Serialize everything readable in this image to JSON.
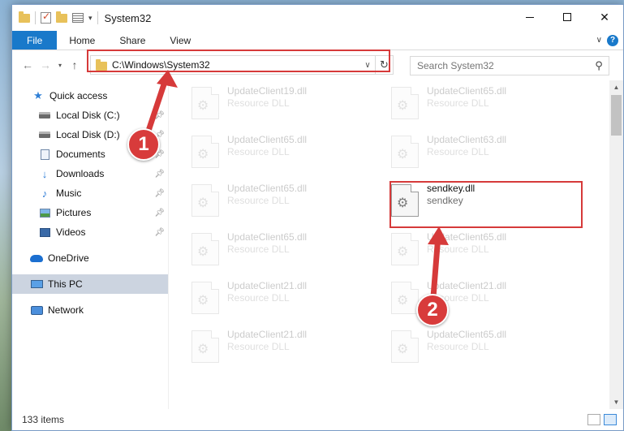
{
  "window": {
    "title": "System32"
  },
  "ribbon": {
    "tabs": [
      {
        "label": "File"
      },
      {
        "label": "Home"
      },
      {
        "label": "Share"
      },
      {
        "label": "View"
      }
    ]
  },
  "address": {
    "path": "C:\\Windows\\System32"
  },
  "search": {
    "placeholder": "Search System32"
  },
  "nav": {
    "items": [
      {
        "label": "Quick access",
        "icon": "star-icon"
      },
      {
        "label": "Local Disk (C:)",
        "icon": "drive-icon",
        "pinned": true
      },
      {
        "label": "Local Disk (D:)",
        "icon": "drive-icon",
        "pinned": true
      },
      {
        "label": "Documents",
        "icon": "documents-icon",
        "pinned": true
      },
      {
        "label": "Downloads",
        "icon": "downloads-icon",
        "pinned": true
      },
      {
        "label": "Music",
        "icon": "music-icon",
        "pinned": true
      },
      {
        "label": "Pictures",
        "icon": "pictures-icon",
        "pinned": true
      },
      {
        "label": "Videos",
        "icon": "videos-icon",
        "pinned": true
      },
      {
        "label": "OneDrive",
        "icon": "onedrive-icon"
      },
      {
        "label": "This PC",
        "icon": "this-pc-icon",
        "selected": true
      },
      {
        "label": "Network",
        "icon": "network-icon"
      }
    ]
  },
  "files": [
    {
      "name": "UpdateClient19.dll",
      "type": "Resource DLL",
      "faded": true
    },
    {
      "name": "UpdateClient65.dll",
      "type": "Resource DLL",
      "faded": true
    },
    {
      "name": "UpdateClient65.dll",
      "type": "Resource DLL",
      "faded": true
    },
    {
      "name": "UpdateClient63.dll",
      "type": "Resource DLL",
      "faded": true
    },
    {
      "name": "UpdateClient65.dll",
      "type": "Resource DLL",
      "faded": true
    },
    {
      "name": "sendkey.dll",
      "type": "sendkey",
      "faded": false
    },
    {
      "name": "UpdateClient65.dll",
      "type": "Resource DLL",
      "faded": true
    },
    {
      "name": "UpdateClient65.dll",
      "type": "Resource DLL",
      "faded": true
    },
    {
      "name": "UpdateClient21.dll",
      "type": "Resource DLL",
      "faded": true
    },
    {
      "name": "UpdateClient21.dll",
      "type": "Resource DLL",
      "faded": true
    },
    {
      "name": "UpdateClient21.dll",
      "type": "Resource DLL",
      "faded": true
    },
    {
      "name": "UpdateClient65.dll",
      "type": "Resource DLL",
      "faded": true
    }
  ],
  "status": {
    "item_count": "133 items"
  },
  "annotations": {
    "step1": "1",
    "step2": "2"
  },
  "colors": {
    "accent": "#1979ca",
    "highlight": "#d63a3a"
  }
}
